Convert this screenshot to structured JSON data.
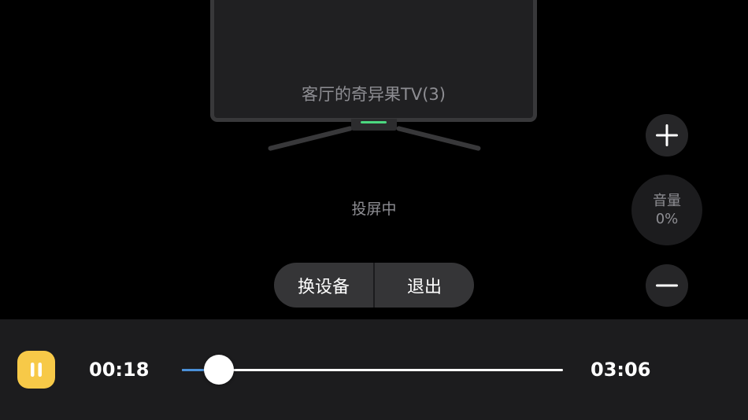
{
  "tv": {
    "device_name": "客厅的奇异果TV(3)"
  },
  "status": {
    "text": "投屏中"
  },
  "actions": {
    "switch_device_label": "换设备",
    "exit_label": "退出"
  },
  "volume": {
    "label": "音量",
    "value": "0%",
    "increase_icon": "plus-icon",
    "decrease_icon": "minus-icon"
  },
  "playback": {
    "state_icon": "pause-icon",
    "current_time": "00:18",
    "total_time": "03:06",
    "progress_fraction": 0.0968
  },
  "colors": {
    "pause_button": "#f7c948",
    "progress_fill": "#4a90d9",
    "tv_indicator": "#4cd880",
    "background": "#000000",
    "bar_background": "#1c1c1e"
  }
}
